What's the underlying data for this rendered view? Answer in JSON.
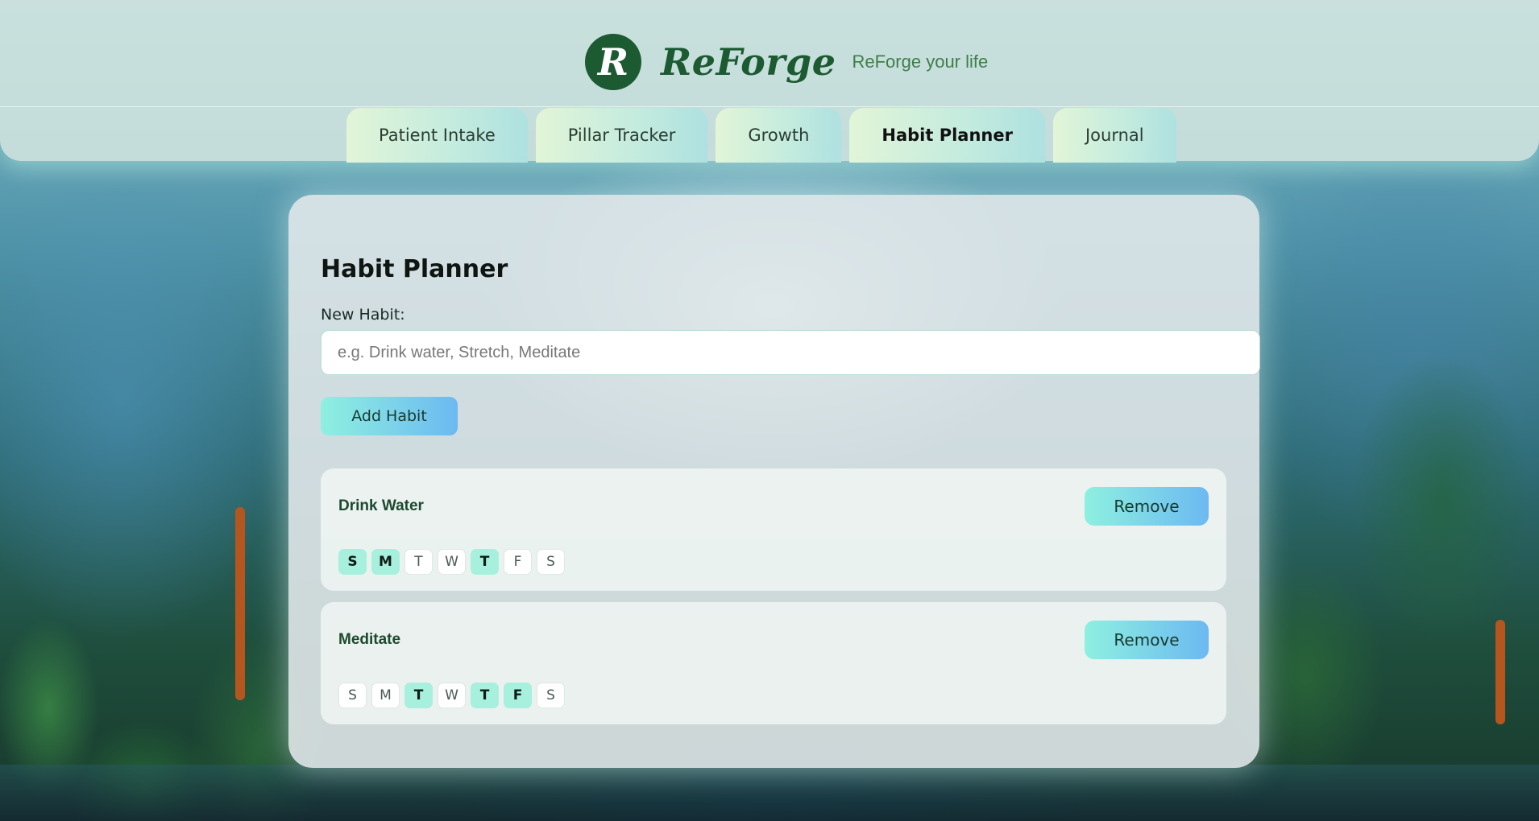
{
  "app": {
    "logo_letter": "R",
    "name": "ReForge",
    "tagline": "ReForge your life"
  },
  "tabs": [
    {
      "label": "Patient Intake",
      "active": false
    },
    {
      "label": "Pillar Tracker",
      "active": false
    },
    {
      "label": "Growth",
      "active": false
    },
    {
      "label": "Habit Planner",
      "active": true
    },
    {
      "label": "Journal",
      "active": false
    }
  ],
  "planner": {
    "title": "Habit Planner",
    "new_habit_label": "New Habit:",
    "input_value": "",
    "input_placeholder": "e.g. Drink water, Stretch, Meditate",
    "add_button": "Add Habit",
    "remove_label": "Remove",
    "habits": [
      {
        "name": "Drink Water",
        "days": [
          {
            "label": "S",
            "selected": true
          },
          {
            "label": "M",
            "selected": true
          },
          {
            "label": "T",
            "selected": false
          },
          {
            "label": "W",
            "selected": false
          },
          {
            "label": "T",
            "selected": true
          },
          {
            "label": "F",
            "selected": false
          },
          {
            "label": "S",
            "selected": false
          }
        ]
      },
      {
        "name": "Meditate",
        "days": [
          {
            "label": "S",
            "selected": false
          },
          {
            "label": "M",
            "selected": false
          },
          {
            "label": "T",
            "selected": true
          },
          {
            "label": "W",
            "selected": false
          },
          {
            "label": "T",
            "selected": true
          },
          {
            "label": "F",
            "selected": true
          },
          {
            "label": "S",
            "selected": false
          }
        ]
      }
    ]
  },
  "colors": {
    "brand_green": "#1c5a32",
    "accent_gradient_start": "#8ef0e0",
    "accent_gradient_end": "#6cb9f1",
    "day_selected": "#a6f0dd"
  }
}
